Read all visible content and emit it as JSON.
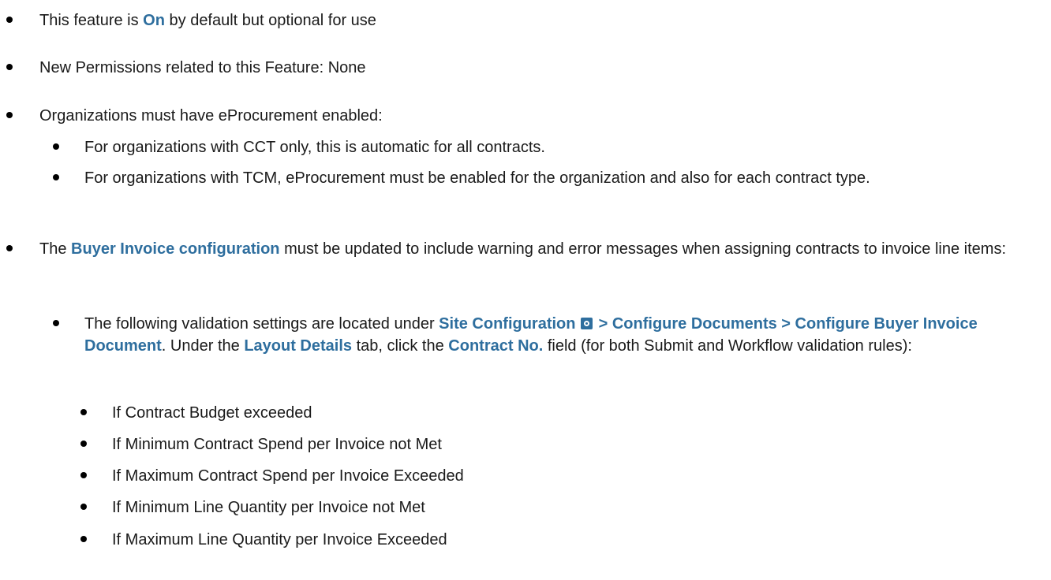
{
  "items": {
    "b1": {
      "pre": "This feature is ",
      "on": "On",
      "post": " by default but optional for use"
    },
    "b2": {
      "text": "New Permissions related to this Feature: None"
    },
    "b3": {
      "text": "Organizations must have eProcurement enabled:",
      "sub1": "For organizations with CCT only, this is automatic for all contracts.",
      "sub2": "For organizations with TCM, eProcurement must be enabled for the organization and also for each contract type."
    },
    "b4": {
      "pre": "The ",
      "kw": "Buyer Invoice configuration",
      "post": " must be updated to include warning and error messages when assigning contracts to invoice line items:",
      "sub": {
        "pre": "The following validation settings are located under ",
        "site_config": "Site Configuration",
        "gear_icon": "gear-icon",
        "path1": " > Configure Documents > Configure Buyer Invoice Document",
        "mid1": ". Under the ",
        "layout": "Layout Details",
        "mid2": " tab, click the ",
        "contract_no": "Contract No.",
        "post": " field (for both Submit and Workflow validation rules):",
        "rules": [
          "If Contract Budget exceeded",
          "If Minimum Contract Spend per Invoice not Met",
          "If Maximum Contract Spend per Invoice Exceeded",
          "If Minimum Line Quantity per Invoice not Met",
          "If Maximum Line Quantity per Invoice Exceeded"
        ]
      }
    }
  },
  "colors": {
    "keyword": "#2e6e9e",
    "text": "#1a1a1a"
  }
}
